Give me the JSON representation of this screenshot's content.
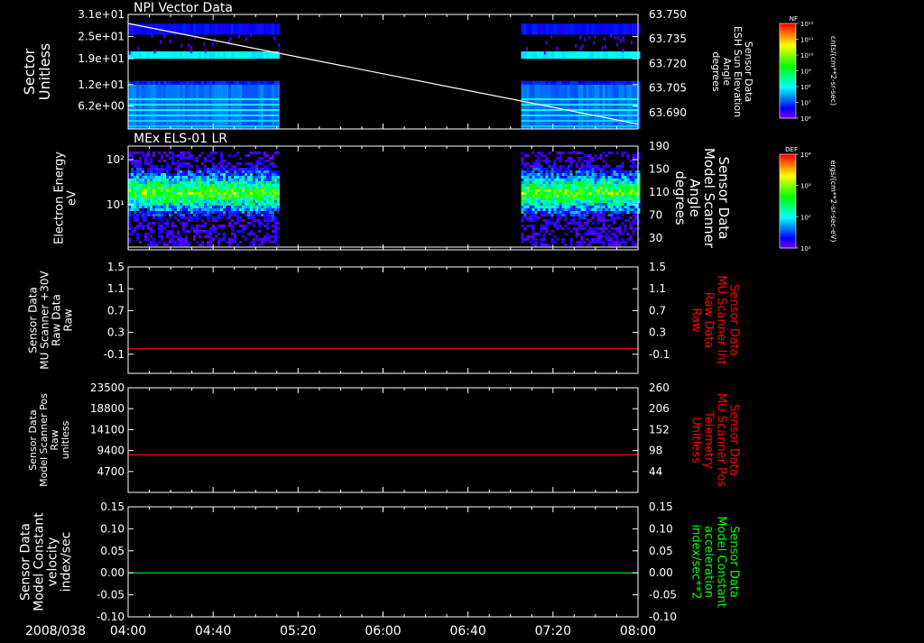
{
  "background": "#000000",
  "time_axis": {
    "date_label": "2008/038",
    "ticks": [
      "04:00",
      "04:40",
      "05:20",
      "06:00",
      "06:40",
      "07:20",
      "08:00"
    ],
    "range": [
      "04:00",
      "08:00"
    ]
  },
  "colorbars": [
    {
      "label": "NF",
      "unit": "cnts/(cm**2-sr-sec)",
      "ticks": [
        "10¹²",
        "10¹¹",
        "10¹⁰",
        "10⁹",
        "10⁸",
        "10⁷",
        "10⁶"
      ],
      "log_range": [
        1000000.0,
        1000000000000.0
      ]
    },
    {
      "label": "DEF",
      "unit": "ergs/(cm**2-sr-sec-eV)",
      "ticks": [
        "10⁴",
        "10³",
        "10²",
        "10¹"
      ],
      "log_range": [
        10,
        10000
      ]
    }
  ],
  "chart_data": [
    {
      "type": "heatmap",
      "title": "NPI Vector Data",
      "ylabel": [
        "Sector",
        "Unitless"
      ],
      "y_ticks": [
        "3.1e+01",
        "2.5e+01",
        "1.9e+01",
        "1.2e+01",
        "6.2e+00"
      ],
      "ylim": [
        0,
        31
      ],
      "right_ylabel": [
        "Sensor Data",
        "ESH Sun Elevation",
        "Angle",
        "degrees"
      ],
      "right_y_ticks": [
        "63.750",
        "63.735",
        "63.720",
        "63.705",
        "63.690"
      ],
      "right_ylim": [
        63.68,
        63.75
      ],
      "data_intervals": [
        [
          "04:00",
          "05:11"
        ],
        [
          "07:05",
          "08:00"
        ]
      ],
      "line_series": {
        "color": "#ffffff",
        "x": [
          "04:00",
          "08:00"
        ],
        "y": [
          63.7445,
          63.683
        ]
      }
    },
    {
      "type": "heatmap",
      "title": "MEx ELS-01 LR",
      "ylabel": [
        "Electron Energy",
        "eV"
      ],
      "y_ticks": [
        "10²",
        "10¹"
      ],
      "ylim": [
        1,
        200
      ],
      "y_scale": "log",
      "right_ylabel": [
        "Sensor Data",
        "Model Scanner",
        "Angle",
        "degrees"
      ],
      "right_y_ticks": [
        "190",
        "150",
        "110",
        "70",
        "30"
      ],
      "right_ylim": [
        10,
        190
      ],
      "data_intervals": [
        [
          "04:00",
          "05:11"
        ],
        [
          "07:05",
          "08:00"
        ]
      ]
    },
    {
      "type": "line",
      "ylabel": [
        "Sensor Data",
        "MU Scanner +30V",
        "Raw Data",
        "Raw"
      ],
      "y_ticks": [
        "1.5",
        "1.1",
        "0.7",
        "0.3",
        "-0.1"
      ],
      "ylim": [
        -0.45,
        1.5
      ],
      "right_ylabel": [
        "Sensor Data",
        "MU Scanner Int",
        "Raw Data",
        "Raw"
      ],
      "right_ylabel_color": "#ff0000",
      "right_y_ticks": [
        "1.5",
        "1.1",
        "0.7",
        "0.3",
        "-0.1"
      ],
      "series": [
        {
          "color": "#ff0000",
          "x": [
            "04:00",
            "08:00"
          ],
          "y": [
            0,
            0
          ]
        }
      ]
    },
    {
      "type": "line",
      "ylabel": [
        "Sensor Data",
        "Model Scanner Pos",
        "Raw",
        "unitless"
      ],
      "y_ticks": [
        "23500",
        "18800",
        "14100",
        "9400",
        "4700"
      ],
      "ylim": [
        0,
        23500
      ],
      "right_ylabel": [
        "Sensor Data",
        "MU Scanner Pos",
        "Telemetry",
        "Unitless"
      ],
      "right_ylabel_color": "#ff0000",
      "right_y_ticks": [
        "260",
        "206",
        "152",
        "98",
        "44"
      ],
      "series": [
        {
          "color": "#ff0000",
          "x": [
            "04:00",
            "08:00"
          ],
          "y": [
            8460,
            8460
          ]
        }
      ]
    },
    {
      "type": "line",
      "ylabel": [
        "Sensor Data",
        "Model Constant",
        "velocity",
        "index/sec"
      ],
      "y_ticks": [
        "0.15",
        "0.10",
        "0.05",
        "0.00",
        "-0.05",
        "-0.10"
      ],
      "ylim": [
        -0.1,
        0.15
      ],
      "right_ylabel": [
        "Sensor Data",
        "Model Constant",
        "acceleration",
        "index/sec**2"
      ],
      "right_ylabel_color": "#00ff00",
      "right_y_ticks": [
        "0.15",
        "0.10",
        "0.05",
        "0.00",
        "-0.05",
        "-0.10"
      ],
      "series": [
        {
          "color": "#00ff00",
          "x": [
            "04:00",
            "08:00"
          ],
          "y": [
            0,
            0
          ]
        }
      ]
    }
  ]
}
